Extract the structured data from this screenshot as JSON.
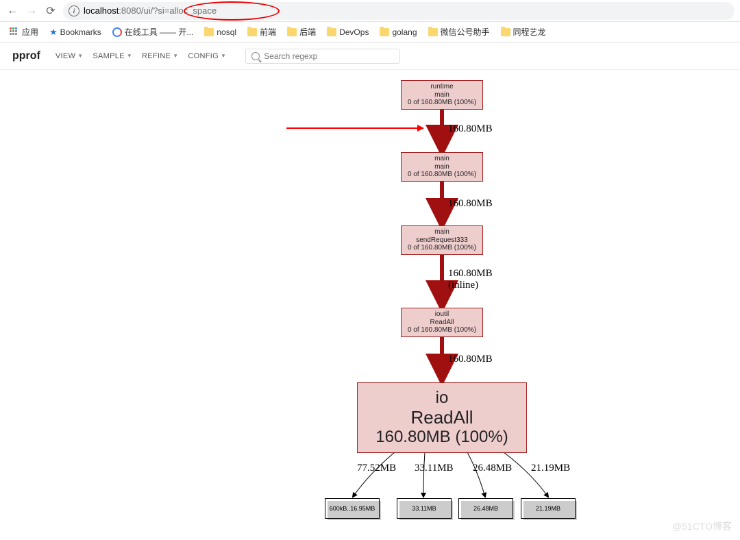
{
  "browser": {
    "url_host": "localhost",
    "url_port": ":8080",
    "url_path": "/ui/?si=alloc_space"
  },
  "bookmarks": {
    "apps": "应用",
    "items": [
      "Bookmarks",
      "在线工具 —— 开...",
      "nosql",
      "前端",
      "后端",
      "DevOps",
      "golang",
      "微信公号助手",
      "同程艺龙"
    ]
  },
  "pprof": {
    "logo": "pprof",
    "menus": [
      "VIEW",
      "SAMPLE",
      "REFINE",
      "CONFIG"
    ],
    "search_placeholder": "Search regexp"
  },
  "graph": {
    "nodes": [
      {
        "pkg": "runtime",
        "func": "main",
        "stat": "0 of 160.80MB (100%)"
      },
      {
        "pkg": "main",
        "func": "main",
        "stat": "0 of 160.80MB (100%)"
      },
      {
        "pkg": "main",
        "func": "sendRequest333",
        "stat": "0 of 160.80MB (100%)"
      },
      {
        "pkg": "ioutil",
        "func": "ReadAll",
        "stat": "0 of 160.80MB (100%)"
      }
    ],
    "big_node": {
      "pkg": "io",
      "func": "ReadAll",
      "stat": "160.80MB (100%)"
    },
    "edges": [
      "160.80MB",
      "160.80MB",
      "160.80MB\n(inline)",
      "160.80MB"
    ],
    "fan_edges": [
      "77.52MB",
      "33.11MB",
      "26.48MB",
      "21.19MB"
    ],
    "leaves": [
      "600kB..16.95MB",
      "33.11MB",
      "26.48MB",
      "21.19MB"
    ]
  },
  "watermark": "@51CTO博客"
}
